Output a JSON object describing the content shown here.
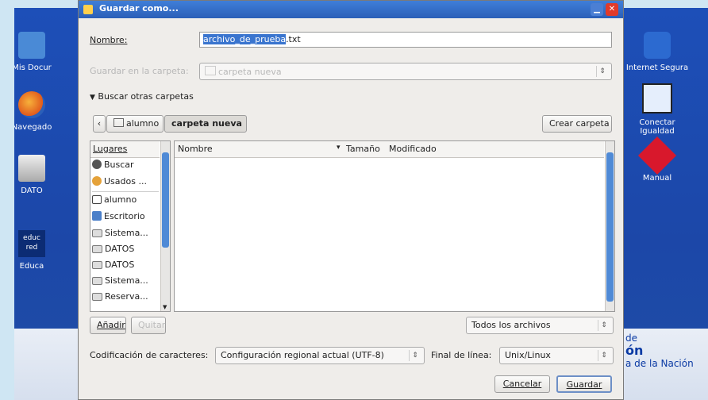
{
  "desktop": {
    "icons_left": [
      {
        "label": "Mis Docur",
        "icon": "folder-icon"
      },
      {
        "label": "Navegado",
        "icon": "firefox-icon"
      },
      {
        "label": "DATO",
        "icon": "drive-icon"
      },
      {
        "label": "Educa",
        "icon": "educ-logo-icon",
        "logo_text": "educ\nred"
      }
    ],
    "icons_right": [
      {
        "label": "Internet Segura",
        "icon": "shield-user-icon"
      },
      {
        "label": "Conectar Igualdad",
        "icon": "monitor-icon"
      },
      {
        "label": "Manual",
        "icon": "diamond-icon"
      }
    ],
    "bottom_text": [
      "de",
      "ón",
      "a de la Nación"
    ]
  },
  "dialog": {
    "title": "Guardar como...",
    "name_label": "Nombre:",
    "name_selected": "archivo_de_prueba",
    "name_rest": ".txt",
    "save_in_label": "Guardar en la carpeta:",
    "save_in_value": "carpeta nueva",
    "browse_toggle": "Buscar otras carpetas",
    "path": [
      "alumno",
      "carpeta nueva"
    ],
    "create_folder": "Crear carpeta",
    "places_header": "Lugares",
    "places": [
      {
        "label": "Buscar",
        "icon": "search-icon"
      },
      {
        "label": "Usados ...",
        "icon": "recent-icon"
      },
      {
        "label": "alumno",
        "icon": "home-folder-icon"
      },
      {
        "label": "Escritorio",
        "icon": "desktop-icon"
      },
      {
        "label": "Sistema...",
        "icon": "drive-icon"
      },
      {
        "label": "DATOS",
        "icon": "drive-icon"
      },
      {
        "label": "DATOS",
        "icon": "drive-icon"
      },
      {
        "label": "Sistema...",
        "icon": "drive-icon"
      },
      {
        "label": "Reserva...",
        "icon": "drive-icon"
      }
    ],
    "columns": {
      "name": "Nombre",
      "size": "Tamaño",
      "modified": "Modificado"
    },
    "add_label": "Añadir",
    "remove_label": "Quitar",
    "filter": "Todos los archivos",
    "encoding_label": "Codificación de caracteres:",
    "encoding_value": "Configuración regional actual (UTF-8)",
    "line_end_label": "Final de línea:",
    "line_end_value": "Unix/Linux",
    "cancel_label": "Cancelar",
    "save_label": "Guardar"
  }
}
